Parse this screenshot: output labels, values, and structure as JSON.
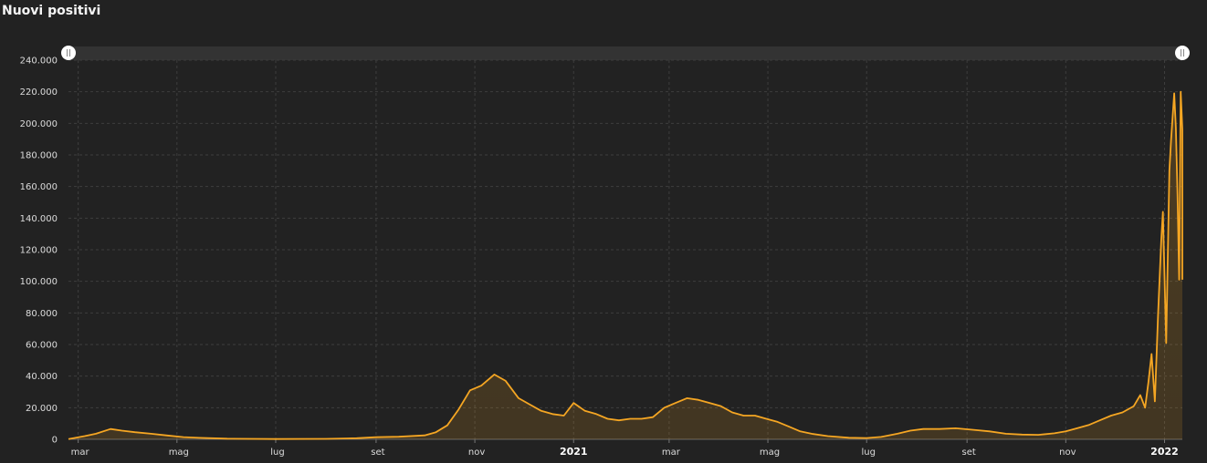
{
  "chart_data": {
    "type": "area",
    "title": "Nuovi positivi",
    "ylim": [
      0,
      240000
    ],
    "y_ticks": [
      "0",
      "20.000",
      "40.000",
      "60.000",
      "80.000",
      "100.000",
      "120.000",
      "140.000",
      "160.000",
      "180.000",
      "200.000",
      "220.000",
      "240.000"
    ],
    "x_range": [
      "2020-02-24",
      "2022-01-12"
    ],
    "x_ticks": [
      {
        "date": "2020-03-01",
        "label": "mar",
        "bold": false
      },
      {
        "date": "2020-05-01",
        "label": "mag",
        "bold": false
      },
      {
        "date": "2020-07-01",
        "label": "lug",
        "bold": false
      },
      {
        "date": "2020-09-01",
        "label": "set",
        "bold": false
      },
      {
        "date": "2020-11-01",
        "label": "nov",
        "bold": false
      },
      {
        "date": "2021-01-01",
        "label": "2021",
        "bold": true
      },
      {
        "date": "2021-03-01",
        "label": "mar",
        "bold": false
      },
      {
        "date": "2021-05-01",
        "label": "mag",
        "bold": false
      },
      {
        "date": "2021-07-01",
        "label": "lug",
        "bold": false
      },
      {
        "date": "2021-09-01",
        "label": "set",
        "bold": false
      },
      {
        "date": "2021-11-01",
        "label": "nov",
        "bold": false
      },
      {
        "date": "2022-01-01",
        "label": "2022",
        "bold": true
      }
    ],
    "series": [
      {
        "color": "#f5a623",
        "points": [
          [
            "2020-02-24",
            200
          ],
          [
            "2020-03-05",
            2000
          ],
          [
            "2020-03-12",
            3500
          ],
          [
            "2020-03-21",
            6500
          ],
          [
            "2020-03-28",
            5500
          ],
          [
            "2020-04-05",
            4500
          ],
          [
            "2020-04-15",
            3500
          ],
          [
            "2020-04-25",
            2400
          ],
          [
            "2020-05-05",
            1400
          ],
          [
            "2020-05-15",
            900
          ],
          [
            "2020-06-01",
            400
          ],
          [
            "2020-07-01",
            200
          ],
          [
            "2020-08-01",
            300
          ],
          [
            "2020-08-20",
            700
          ],
          [
            "2020-09-01",
            1300
          ],
          [
            "2020-09-15",
            1600
          ],
          [
            "2020-10-01",
            2500
          ],
          [
            "2020-10-08",
            4500
          ],
          [
            "2020-10-15",
            8800
          ],
          [
            "2020-10-22",
            19000
          ],
          [
            "2020-10-29",
            31000
          ],
          [
            "2020-11-05",
            34000
          ],
          [
            "2020-11-13",
            41000
          ],
          [
            "2020-11-20",
            37000
          ],
          [
            "2020-11-28",
            26000
          ],
          [
            "2020-12-05",
            22000
          ],
          [
            "2020-12-12",
            18000
          ],
          [
            "2020-12-19",
            16000
          ],
          [
            "2020-12-26",
            15000
          ],
          [
            "2021-01-01",
            23000
          ],
          [
            "2021-01-08",
            18000
          ],
          [
            "2021-01-15",
            16000
          ],
          [
            "2021-01-22",
            13000
          ],
          [
            "2021-01-29",
            12000
          ],
          [
            "2021-02-05",
            13000
          ],
          [
            "2021-02-12",
            13000
          ],
          [
            "2021-02-19",
            14000
          ],
          [
            "2021-02-26",
            20000
          ],
          [
            "2021-03-05",
            23000
          ],
          [
            "2021-03-12",
            26000
          ],
          [
            "2021-03-19",
            25000
          ],
          [
            "2021-03-26",
            23000
          ],
          [
            "2021-04-02",
            21000
          ],
          [
            "2021-04-09",
            17000
          ],
          [
            "2021-04-16",
            15000
          ],
          [
            "2021-04-23",
            15000
          ],
          [
            "2021-04-30",
            13000
          ],
          [
            "2021-05-07",
            11000
          ],
          [
            "2021-05-14",
            8000
          ],
          [
            "2021-05-21",
            5000
          ],
          [
            "2021-05-28",
            3500
          ],
          [
            "2021-06-07",
            2000
          ],
          [
            "2021-06-20",
            1000
          ],
          [
            "2021-07-01",
            800
          ],
          [
            "2021-07-10",
            1500
          ],
          [
            "2021-07-20",
            3500
          ],
          [
            "2021-07-28",
            5500
          ],
          [
            "2021-08-05",
            6500
          ],
          [
            "2021-08-15",
            6500
          ],
          [
            "2021-08-25",
            7000
          ],
          [
            "2021-09-05",
            6000
          ],
          [
            "2021-09-15",
            5000
          ],
          [
            "2021-09-25",
            3500
          ],
          [
            "2021-10-05",
            3000
          ],
          [
            "2021-10-15",
            2800
          ],
          [
            "2021-10-25",
            3800
          ],
          [
            "2021-11-01",
            5000
          ],
          [
            "2021-11-08",
            7000
          ],
          [
            "2021-11-15",
            9000
          ],
          [
            "2021-11-22",
            12000
          ],
          [
            "2021-11-29",
            15000
          ],
          [
            "2021-12-06",
            17000
          ],
          [
            "2021-12-13",
            21000
          ],
          [
            "2021-12-17",
            28000
          ],
          [
            "2021-12-20",
            20000
          ],
          [
            "2021-12-22",
            36000
          ],
          [
            "2021-12-24",
            54000
          ],
          [
            "2021-12-26",
            24000
          ],
          [
            "2021-12-28",
            79000
          ],
          [
            "2021-12-30",
            126000
          ],
          [
            "2021-12-31",
            144000
          ],
          [
            "2022-01-02",
            61000
          ],
          [
            "2022-01-04",
            170000
          ],
          [
            "2022-01-05",
            189000
          ],
          [
            "2022-01-07",
            219000
          ],
          [
            "2022-01-08",
            197000
          ],
          [
            "2022-01-09",
            155000
          ],
          [
            "2022-01-10",
            101000
          ],
          [
            "2022-01-11",
            220000
          ],
          [
            "2022-01-12",
            196000
          ],
          [
            "2022-01-12",
            101000
          ]
        ]
      }
    ]
  }
}
